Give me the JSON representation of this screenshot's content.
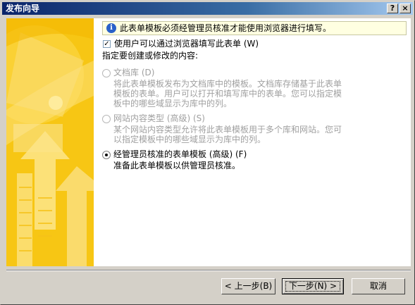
{
  "window": {
    "title": "发布向导",
    "help_button": "?",
    "close_button": "×"
  },
  "info": {
    "text": "此表单模板必须经管理员核准才能使用浏览器进行填写。"
  },
  "browser_checkbox": {
    "label": "使用户可以通过浏览器填写此表单 (W)",
    "checked": true
  },
  "section_label": "指定要创建或修改的内容:",
  "options": [
    {
      "label": "文档库 (D)",
      "description": "将此表单模板发布为文档库中的模板。文档库存储基于此表单模板的表单。用户可以打开和填写库中的表单。您可以指定模板中的哪些域显示为库中的列。",
      "enabled": false,
      "selected": false
    },
    {
      "label": "网站内容类型 (高级) (S)",
      "description": "某个网站内容类型允许将此表单模板用于多个库和网站。您可以指定模板中的哪些域显示为库中的列。",
      "enabled": false,
      "selected": false
    },
    {
      "label": "经管理员核准的表单模板 (高级) (F)",
      "description": "准备此表单模板以供管理员核准。",
      "enabled": true,
      "selected": true
    }
  ],
  "buttons": {
    "back": "< 上一步(B)",
    "next": "下一步(N) >",
    "cancel": "取消"
  },
  "colors": {
    "art_background": "#f7c614",
    "title_bar": "#0a246a",
    "info_background": "#ffffe1"
  }
}
